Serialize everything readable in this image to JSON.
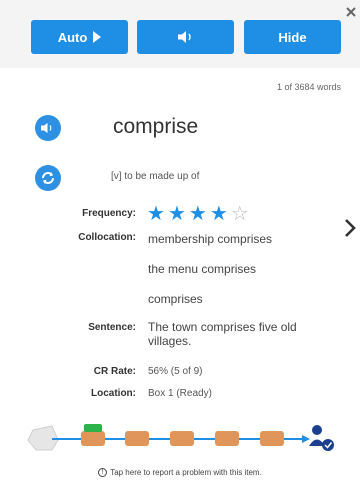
{
  "toolbar": {
    "auto_label": "Auto",
    "hide_label": "Hide",
    "sound_icon": "speaker-icon",
    "accent": "#1f8fe5"
  },
  "word_count": "1 of 3684 words",
  "word": "comprise",
  "definition": "[v] to be made up of",
  "frequency": {
    "label": "Frequency:",
    "rating": 4,
    "max": 5
  },
  "collocation": {
    "label": "Collocation:",
    "items": [
      "membership comprises",
      "the menu comprises",
      "comprises"
    ]
  },
  "sentence": {
    "label": "Sentence:",
    "lines": [
      "The town comprises five old",
      "villages."
    ]
  },
  "cr_rate": {
    "label": "CR Rate:",
    "value": "56% (5 of 9)"
  },
  "location": {
    "label": "Location:",
    "value": "Box 1 (Ready)"
  },
  "progress": {
    "boxes": 5,
    "current_box": 1,
    "box_color": "#e0955a",
    "current_color": "#2db34a",
    "line_color": "#1f8fe5"
  },
  "report_text": "Tap here to report a problem with this item.",
  "icons": {
    "speak": "speaker-circle-icon",
    "refresh": "refresh-icon",
    "next": "chevron-right-icon",
    "person": "person-check-icon",
    "close": "close-icon"
  }
}
